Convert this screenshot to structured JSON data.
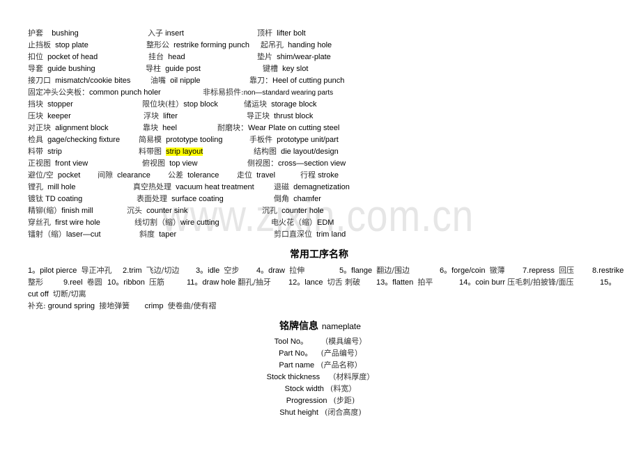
{
  "watermark": "www.zixin.com.cn",
  "glossary": [
    [
      {
        "zh": "护套",
        "en": "bushing"
      },
      {
        "zh": "入子",
        "en": "insert"
      },
      {
        "zh": "顶杆",
        "en": "lifter bolt"
      }
    ],
    [
      {
        "zh": "止挡板",
        "en": "stop plate"
      },
      {
        "zh": "整形公",
        "en": "restrike forming punch"
      },
      {
        "zh": "起吊孔",
        "en": "handing hole"
      }
    ],
    [
      {
        "zh": "扣位",
        "en": "pocket of head"
      },
      {
        "zh": "挂台",
        "en": "head"
      },
      {
        "zh": "垫片",
        "en": "shim/wear-plate"
      }
    ],
    [
      {
        "zh": "导套",
        "en": "guide bushing"
      },
      {
        "zh": "导柱",
        "en": "guide post"
      },
      {
        "zh": "键槽",
        "en": "key slot"
      }
    ],
    [
      {
        "zh": "接刀口",
        "en": "mismatch/cookie bites"
      },
      {
        "zh": "油嘴",
        "en": "oil nipple"
      },
      {
        "zh": "靠刀：",
        "en": "Heel of cutting punch"
      }
    ],
    [
      {
        "zh": "固定冲头公夹板：",
        "en": "common punch holer"
      },
      {
        "zh": "非标易损件:",
        "en": "non—standard wearing parts"
      }
    ],
    [
      {
        "zh": "挡块",
        "en": "stopper"
      },
      {
        "zh": "限位块(柱）",
        "en": "stop block"
      },
      {
        "zh": "储运块",
        "en": "storage block"
      }
    ],
    [
      {
        "zh": "压块",
        "en": "keeper"
      },
      {
        "zh": "浮块",
        "en": "lifter"
      },
      {
        "zh": "导正块",
        "en": "thrust block"
      }
    ],
    [
      {
        "zh": "对正块",
        "en": "alignment block"
      },
      {
        "zh": "靠块",
        "en": "heel"
      },
      {
        "zh": "耐磨块：",
        "en": "Wear Plate on cutting steel"
      }
    ],
    [
      {
        "zh": "检具",
        "en": "gage/checking fixture"
      },
      {
        "zh": "简易模",
        "en": "prototype tooling"
      },
      {
        "zh": "手板件",
        "en": "prototype unit/part"
      }
    ],
    [
      {
        "zh": "料带",
        "en": "strip"
      },
      {
        "zh": "料带图",
        "en": "strip layout"
      },
      {
        "zh": "结构图",
        "en": "die layout/design"
      }
    ],
    [
      {
        "zh": "正视图",
        "en": "front view"
      },
      {
        "zh": "俯视图",
        "en": "top view"
      },
      {
        "zh": "侧视图：",
        "en": "cross—section view"
      }
    ],
    [
      {
        "zh": "避位/空",
        "en": "pocket"
      },
      {
        "zh": "间隙",
        "en": "clearance"
      },
      {
        "zh": "公差",
        "en": "tolerance"
      },
      {
        "zh": "走位",
        "en": "travel"
      },
      {
        "zh": "行程",
        "en": "stroke"
      }
    ],
    [
      {
        "zh": "镗孔",
        "en": "mill hole"
      },
      {
        "zh": "真空热处理",
        "en": "vacuum heat treatment"
      },
      {
        "zh": "退磁",
        "en": "demagnetization"
      }
    ],
    [
      {
        "zh": "镀钛",
        "en": "TD coating"
      },
      {
        "zh": "表面处理",
        "en": "surface coating"
      },
      {
        "zh": "倒角",
        "en": "chamfer"
      }
    ],
    [
      {
        "zh": "精铆(缩）",
        "en": "finish mill"
      },
      {
        "zh": "沉头",
        "en": "counter sink"
      },
      {
        "zh": "沉孔",
        "en": "counter hole"
      }
    ],
    [
      {
        "zh": "穿丝孔",
        "en": "first wire hole"
      },
      {
        "zh": "线切割（缩）",
        "en": "wire cutting"
      },
      {
        "zh": "电火花（缩）",
        "en": "EDM"
      }
    ],
    [
      {
        "zh": "镭射（缩）",
        "en": "laser—cut"
      },
      {
        "zh": "斜度",
        "en": "taper"
      },
      {
        "zh": "剪口直深位",
        "en": "trim land"
      }
    ]
  ],
  "process_section": {
    "heading": "常用工序名称",
    "items": [
      {
        "num": "1。",
        "en": "pilot pierce",
        "zh": "导正冲孔"
      },
      {
        "num": "2.",
        "en": "trim",
        "zh": "飞边/切边"
      },
      {
        "num": "3。",
        "en": "idle",
        "zh": "空步"
      },
      {
        "num": "4。",
        "en": "draw",
        "zh": "拉伸"
      },
      {
        "num": "5。",
        "en": "flange",
        "zh": "翻边/围边"
      },
      {
        "num": "6。",
        "en": "forge/coin",
        "zh": "镦薄"
      },
      {
        "num": "7.",
        "en": "repress",
        "zh": "回压"
      },
      {
        "num": "8.",
        "en": "restrike",
        "zh": "整形"
      },
      {
        "num": "9.",
        "en": "reel",
        "zh": "卷圆"
      },
      {
        "num": "10。",
        "en": "ribbon",
        "zh": "压筋"
      },
      {
        "num": "11。",
        "en": "draw hole",
        "zh": "翻孔/抽牙"
      },
      {
        "num": "12。",
        "en": "lance",
        "zh": "切舌 刺破"
      },
      {
        "num": "13。",
        "en": "flatten",
        "zh": "拍平"
      },
      {
        "num": "14。",
        "en": "coin burr",
        "zh": "压毛刺/拍披锋/面压"
      },
      {
        "num": "15。",
        "en": "cut off",
        "zh": "切断/切离"
      }
    ],
    "supplement_label": "补充:",
    "supplement": [
      {
        "en": "ground spring",
        "zh": "接地弹簧"
      },
      {
        "en": "crimp",
        "zh": "使卷曲/使有褶"
      }
    ]
  },
  "nameplate": {
    "heading_zh": "铭牌信息",
    "heading_en": "nameplate",
    "fields": [
      {
        "en": "Tool No。",
        "zh": "（模具编号）"
      },
      {
        "en": "Part No。",
        "zh": "(产品编号）"
      },
      {
        "en": "Part name",
        "zh": "(产品名称）"
      },
      {
        "en": "Stock thickness",
        "zh": "（材料厚度）"
      },
      {
        "en": "Stock width",
        "zh": "(料宽）"
      },
      {
        "en": "Progression",
        "zh": "(步距)"
      },
      {
        "en": "Shut height",
        "zh": "(闭合高度)"
      }
    ]
  }
}
